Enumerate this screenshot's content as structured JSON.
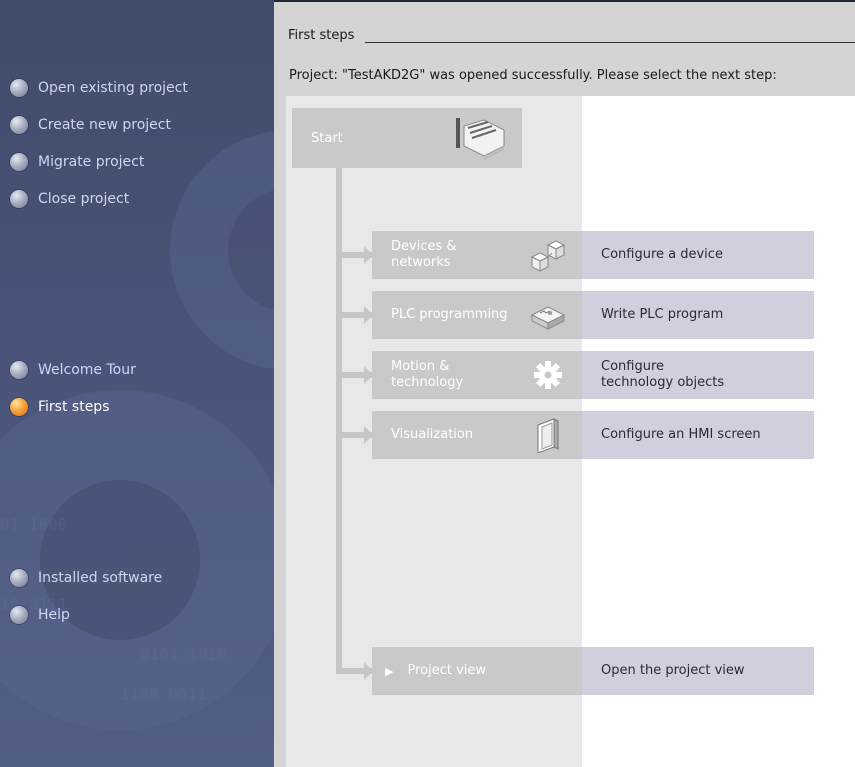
{
  "nav": {
    "top_items": [
      {
        "label": "Open existing project"
      },
      {
        "label": "Create new project"
      },
      {
        "label": "Migrate project"
      },
      {
        "label": "Close project"
      }
    ],
    "middle_items": [
      {
        "label": "Welcome Tour"
      },
      {
        "label": "First steps",
        "active": true
      }
    ],
    "bottom_items": [
      {
        "label": "Installed software"
      },
      {
        "label": "Help"
      }
    ],
    "active_color": "#f7a33a"
  },
  "main": {
    "section_title": "First steps",
    "status": "Project: \"TestAKD2G\" was opened successfully. Please select the next step:",
    "start_label": "Start",
    "steps": [
      {
        "label_lines": [
          "Devices &",
          "networks"
        ],
        "desc_lines": [
          "Configure a device"
        ],
        "icon": "devices-icon"
      },
      {
        "label_lines": [
          "PLC programming"
        ],
        "desc_lines": [
          "Write PLC program"
        ],
        "icon": "plc-icon"
      },
      {
        "label_lines": [
          "Motion &",
          "technology"
        ],
        "desc_lines": [
          "Configure",
          "technology objects"
        ],
        "icon": "gear-icon"
      },
      {
        "label_lines": [
          "Visualization"
        ],
        "desc_lines": [
          "Configure an HMI screen"
        ],
        "icon": "hmi-screen-icon"
      }
    ],
    "project_view": {
      "label": "Project view",
      "desc": "Open the project view",
      "icon": "chevron-right-icon"
    }
  },
  "colors": {
    "nav_bg": "#4a5479",
    "step_bg": "#c9c9c9",
    "desc_bg": "#cfcfde"
  }
}
